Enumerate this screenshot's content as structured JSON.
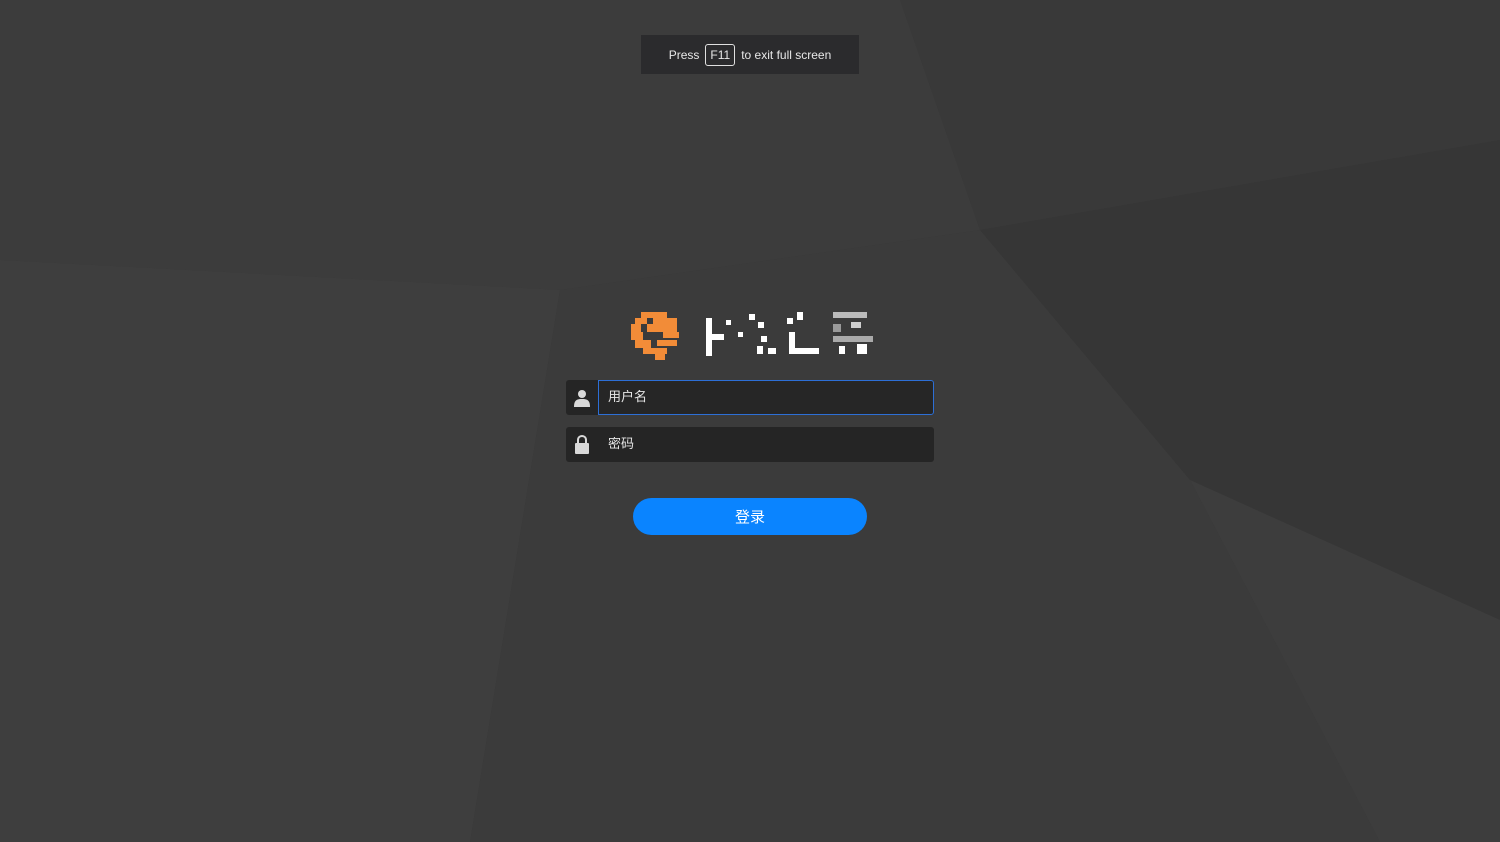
{
  "fullscreen_notice": {
    "before": "Press",
    "key": "F11",
    "after": "to exit full screen"
  },
  "logo": {
    "icon": "brand-logo-icon",
    "accent_color": "#f28c38"
  },
  "login": {
    "username_placeholder": "用户名",
    "password_placeholder": "密码",
    "submit_label": "登录"
  },
  "colors": {
    "background": "#3a3a3a",
    "input_background": "#252525",
    "focus_border": "#2d6fd6",
    "button": "#0a84ff"
  },
  "icons": {
    "username": "user-icon",
    "password": "lock-icon"
  }
}
